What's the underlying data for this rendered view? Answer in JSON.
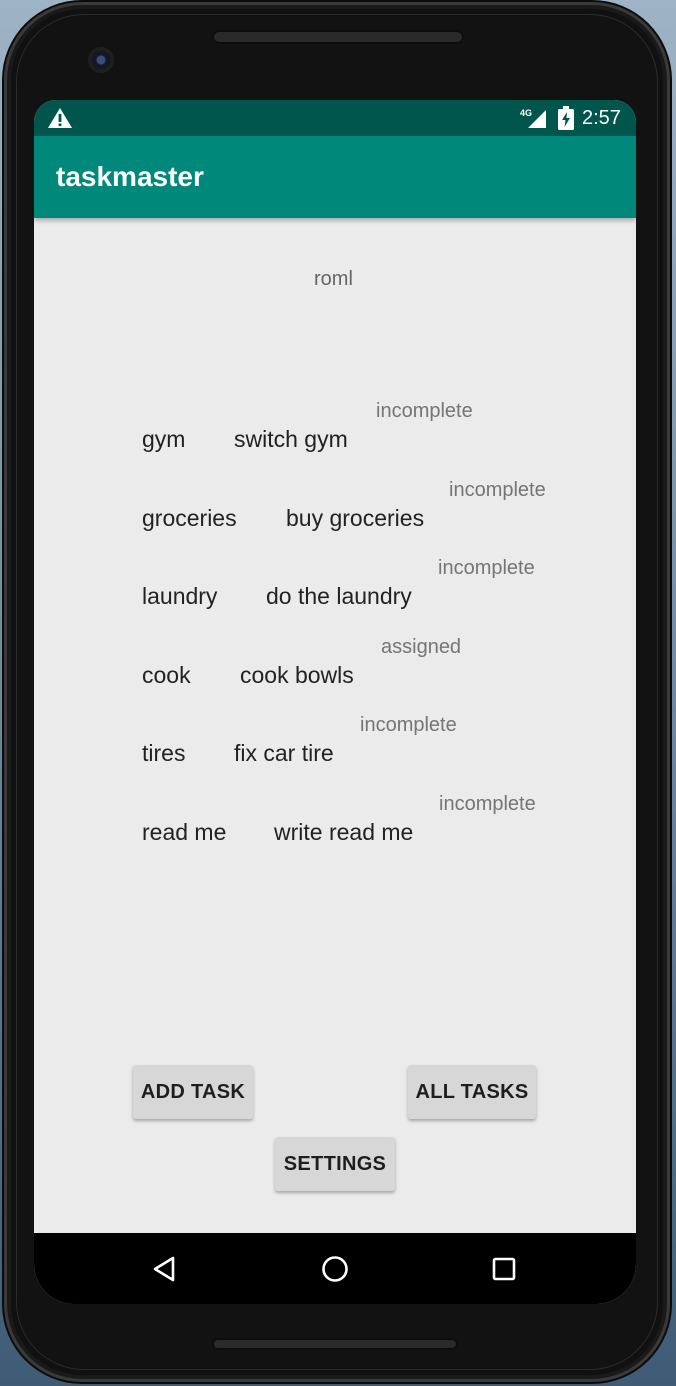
{
  "status_bar": {
    "time": "2:57",
    "network_label": "4G",
    "icons": [
      "warning-icon",
      "cell-signal-icon",
      "battery-charging-icon"
    ]
  },
  "app_bar": {
    "title": "taskmaster",
    "color": "#00897b",
    "status_color": "#00564c"
  },
  "main": {
    "username": "roml",
    "tasks": [
      {
        "title": "gym",
        "body": "switch gym",
        "state": "incomplete"
      },
      {
        "title": "groceries",
        "body": "buy groceries",
        "state": "incomplete"
      },
      {
        "title": "laundry",
        "body": "do the laundry",
        "state": "incomplete"
      },
      {
        "title": "cook",
        "body": "cook bowls",
        "state": "assigned"
      },
      {
        "title": "tires",
        "body": "fix car tire",
        "state": "incomplete"
      },
      {
        "title": "read me",
        "body": "write read me",
        "state": "incomplete"
      }
    ]
  },
  "buttons": {
    "add_task": "ADD TASK",
    "all_tasks": "ALL TASKS",
    "settings": "SETTINGS"
  },
  "nav_bar": {
    "icons": [
      "back-icon",
      "home-icon",
      "recents-icon"
    ]
  }
}
